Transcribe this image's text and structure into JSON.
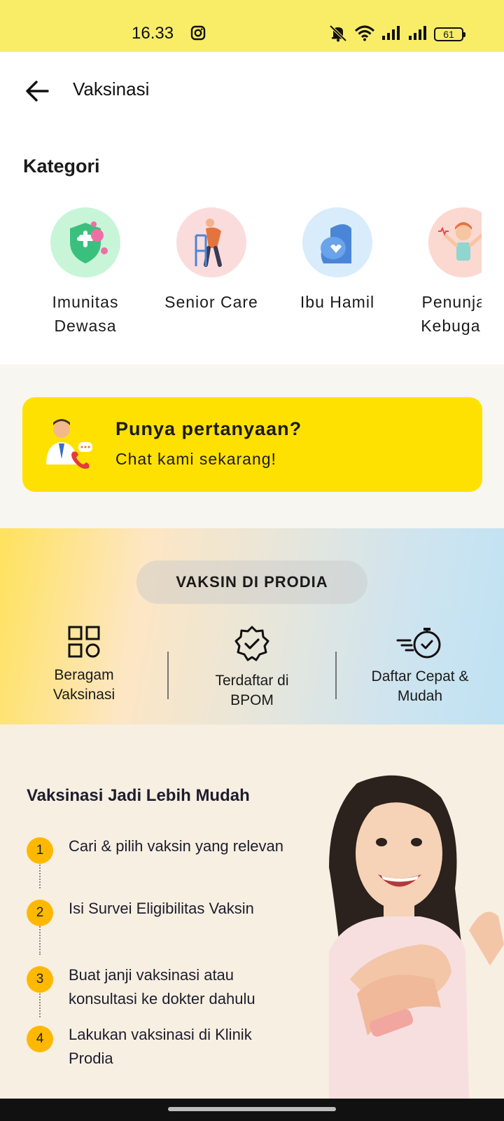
{
  "status_bar": {
    "time": "16.33",
    "battery": "61"
  },
  "app_bar": {
    "title": "Vaksinasi"
  },
  "kategori": {
    "title": "Kategori",
    "items": [
      {
        "label": "Imunitas\nDewasa",
        "icon": "shield-virus-icon",
        "bg": "#c8f5d8"
      },
      {
        "label": "Senior Care",
        "icon": "elderly-walker-icon",
        "bg": "#fbdcdc"
      },
      {
        "label": "Ibu Hamil",
        "icon": "pregnant-woman-icon",
        "bg": "#d8ecfb"
      },
      {
        "label": "Penunjang\nKebugaran",
        "icon": "fitness-woman-icon",
        "bg": "#fbd8d0"
      }
    ]
  },
  "chat_card": {
    "title": "Punya pertanyaan?",
    "subtitle": "Chat kami sekarang!",
    "icon": "doctor-phone-icon"
  },
  "vaksin_section": {
    "pill": "VAKSIN DI PRODIA",
    "features": [
      {
        "label": "Beragam\nVaksinasi",
        "icon": "grid-shapes-icon"
      },
      {
        "label": "Terdaftar di\nBPOM",
        "icon": "verified-badge-icon"
      },
      {
        "label": "Daftar Cepat &\nMudah",
        "icon": "fast-stopwatch-icon"
      }
    ]
  },
  "promo": {
    "title": "Vaksinasi Jadi Lebih Mudah",
    "steps": [
      {
        "num": "1",
        "text": "Cari & pilih vaksin yang relevan"
      },
      {
        "num": "2",
        "text": "Isi Survei Eligibilitas Vaksin"
      },
      {
        "num": "3",
        "text": "Buat janji vaksinasi atau konsultasi ke dokter dahulu"
      },
      {
        "num": "4",
        "text": "Lakukan vaksinasi di Klinik Prodia"
      }
    ]
  },
  "colors": {
    "accent_yellow": "#ffe100",
    "step_orange": "#ffb800",
    "statusbar": "#f9ed68"
  }
}
